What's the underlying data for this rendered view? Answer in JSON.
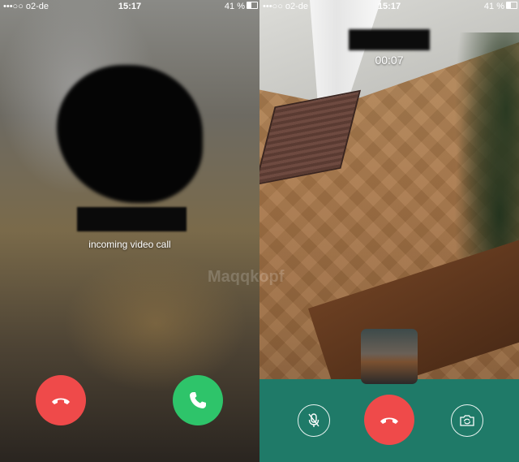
{
  "status_bar": {
    "carrier": "•••○○ o2-de",
    "time": "15:17",
    "battery": "41 %"
  },
  "incoming_screen": {
    "call_label": "incoming video call",
    "decline_icon": "phone-hangup-icon",
    "accept_icon": "phone-icon",
    "decline_color": "#ef4a4a",
    "accept_color": "#2ec46a"
  },
  "active_screen": {
    "timer": "00:07",
    "mute_icon": "mic-off-icon",
    "end_icon": "phone-hangup-icon",
    "switch_camera_icon": "camera-switch-icon",
    "bar_color": "#1f7a68"
  },
  "watermark": "Maqqkopf"
}
